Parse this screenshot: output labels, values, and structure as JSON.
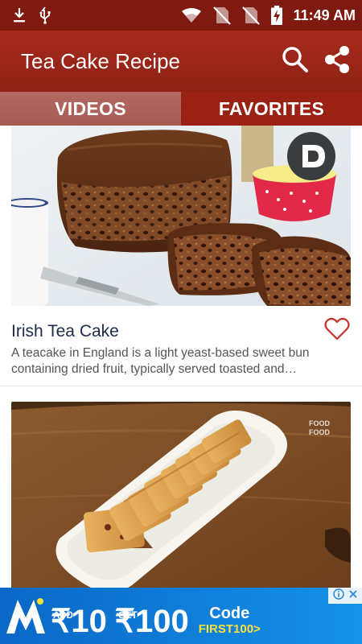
{
  "status_bar": {
    "time": "11:49 AM",
    "icons": [
      "download-icon",
      "usb-icon",
      "wifi-icon",
      "no-sim-icon",
      "no-sim-icon",
      "battery-charging-icon"
    ]
  },
  "app_bar": {
    "title": "Tea Cake Recipe",
    "actions": [
      "search-icon",
      "share-icon"
    ],
    "color": "#9a2215"
  },
  "tabs": [
    {
      "label": "VIDEOS",
      "selected": false
    },
    {
      "label": "FAVORITES",
      "selected": true
    }
  ],
  "recipes": [
    {
      "title": "Irish Tea Cake",
      "description": "A teacake in England is a light yeast-based sweet bun containing dried fruit, typically served toasted and…",
      "favorite_icon": "heart-outline-icon",
      "badge_letter": "D",
      "favorited": false
    },
    {
      "watermark": "FOOD FOOD"
    }
  ],
  "ad": {
    "brand": "M",
    "offer1_small": [
      "ADD",
      "₹"
    ],
    "offer1_big": "₹10",
    "offer2_small": [
      "GET",
      "₹"
    ],
    "offer2_big": "₹100",
    "code_label": "Code",
    "code_value": "FIRST100>",
    "icons": [
      "info-icon",
      "close-icon"
    ]
  },
  "colors": {
    "primary": "#9a2215",
    "status_bar": "#7e1a10",
    "tab_unselected": "#a55a52",
    "heart": "#c2352a",
    "ad_blue": "#0e7ad6",
    "ad_yellow": "#ffe23a"
  }
}
